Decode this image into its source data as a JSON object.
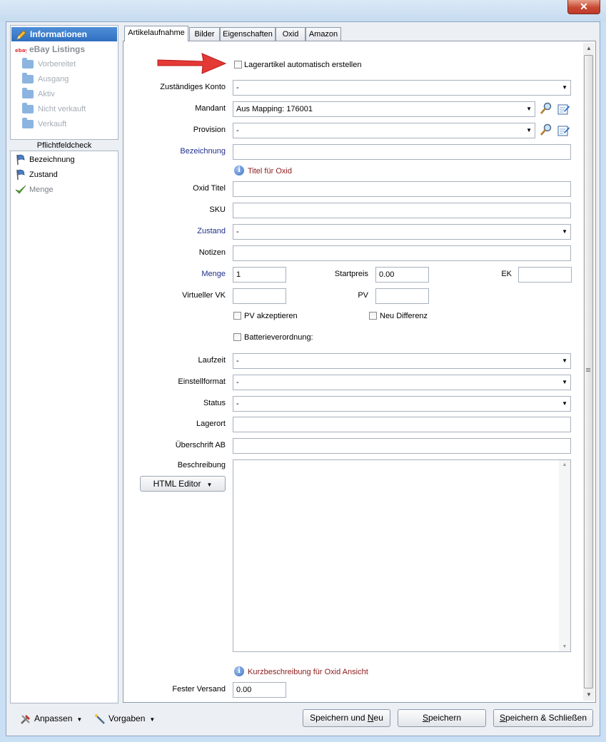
{
  "window": {
    "close_glyph": "✕"
  },
  "sidebar": {
    "active_item": "Informationen",
    "group": "eBay Listings",
    "ebay_logo": "ebay",
    "sub_items": [
      "Vorbereitet",
      "Ausgang",
      "Aktiv",
      "Nicht verkauft",
      "Verkauft"
    ],
    "pflicht_title": "Pflichtfeldcheck",
    "pflicht_items": [
      {
        "label": "Bezeichnung",
        "state": "pending",
        "icon": "flag-icon"
      },
      {
        "label": "Zustand",
        "state": "pending",
        "icon": "flag-icon"
      },
      {
        "label": "Menge",
        "state": "done",
        "icon": "checkmark-icon"
      }
    ]
  },
  "tabs": [
    "Artikelaufnahme",
    "Bilder",
    "Eigenschaften",
    "Oxid",
    "Amazon"
  ],
  "form": {
    "lager_checkbox": "Lagerartikel automatisch erstellen",
    "konto_label": "Zuständiges Konto",
    "konto_value": "-",
    "mandant_label": "Mandant",
    "mandant_value": "Aus Mapping: 176001",
    "provision_label": "Provision",
    "provision_value": "-",
    "bezeichnung_label": "Bezeichnung",
    "bezeichnung_value": "",
    "titel_info": "Titel für Oxid",
    "oxid_titel_label": "Oxid Titel",
    "oxid_titel_value": "",
    "sku_label": "SKU",
    "sku_value": "",
    "zustand_label": "Zustand",
    "zustand_value": "-",
    "notizen_label": "Notizen",
    "notizen_value": "",
    "menge_label": "Menge",
    "menge_value": "1",
    "startpreis_label": "Startpreis",
    "startpreis_value": "0.00",
    "ek_label": "EK",
    "ek_value": "",
    "vvk_label": "Virtueller VK",
    "vvk_value": "",
    "pv_label": "PV",
    "pv_value": "",
    "pv_akzept": "PV akzeptieren",
    "neu_diff": "Neu Differenz",
    "batterie": "Batterieverordnung:",
    "laufzeit_label": "Laufzeit",
    "laufzeit_value": "-",
    "einstell_label": "Einstellformat",
    "einstell_value": "-",
    "status_label": "Status",
    "status_value": "-",
    "lagerort_label": "Lagerort",
    "lagerort_value": "",
    "ueberschrift_label": "Überschrift AB",
    "ueberschrift_value": "",
    "beschreibung_label": "Beschreibung",
    "html_editor": "HTML Editor",
    "kurz_info": "Kurzbeschreibung für Oxid Ansicht",
    "versand_label": "Fester Versand",
    "versand_value": "0.00"
  },
  "footer": {
    "anpassen": "Anpassen",
    "vorgaben": "Vorgaben",
    "save_new_a": "Speichern und ",
    "save_new_u": "N",
    "save_new_b": "eu",
    "save_u": "S",
    "save_b": "peichern",
    "save_close_u": "S",
    "save_close_b": "peichern & Schließen"
  },
  "colors": {
    "accent": "#2f6fc0",
    "info_text": "#8b1a1a",
    "label_blue": "#1f2f8a",
    "arrow": "#e53935"
  }
}
